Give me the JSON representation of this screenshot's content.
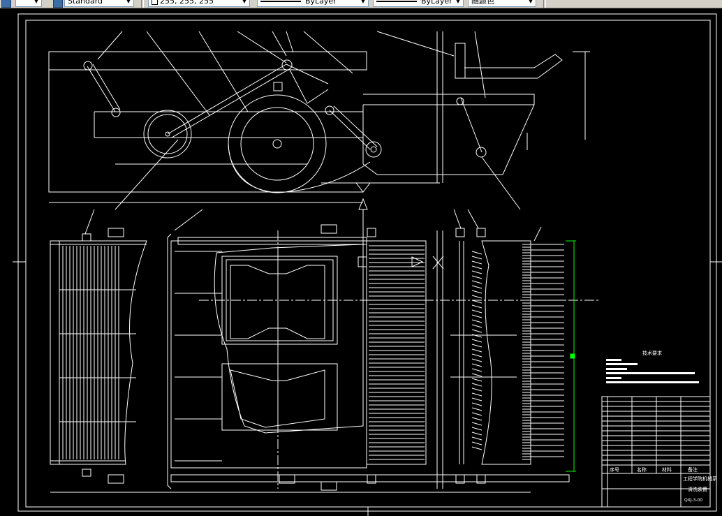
{
  "toolbar": {
    "text_style": "Standard",
    "color": "255, 255, 255",
    "linetype": "ByLayer",
    "lineweight": "ByLayer",
    "plot_style": "随颜色"
  },
  "drawing": {
    "tech_req_title": "技术要求",
    "title_block": {
      "school": "工程学院机械系",
      "drawing_name": "清洗装置",
      "drawing_no": "QXJ-3-00",
      "col_seq": "序号",
      "col_name": "名称",
      "col_material": "材料",
      "col_remark": "备注"
    }
  },
  "colors": {
    "canvas": "#000000",
    "lines": "#ffffff",
    "selection": "#00ff00",
    "toolbar": "#d4d0c8"
  }
}
